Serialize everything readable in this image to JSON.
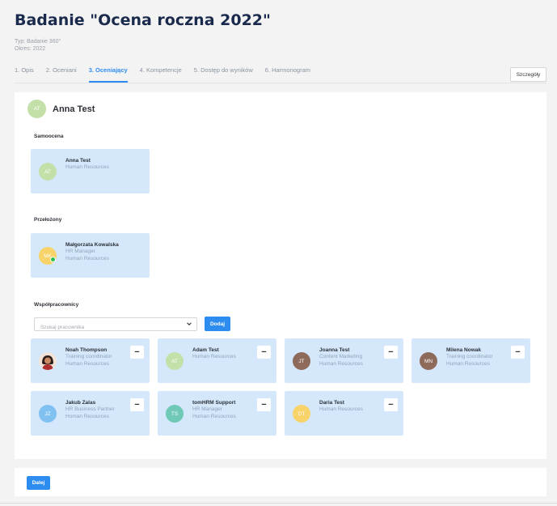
{
  "header": {
    "title": "Badanie \"Ocena roczna 2022\"",
    "type_line": "Typ: Badanie 360°",
    "period_line": "Okres: 2022",
    "details_label": "Szczegóły"
  },
  "tabs": [
    {
      "label": "1. Opis",
      "active": false
    },
    {
      "label": "2. Oceniani",
      "active": false
    },
    {
      "label": "3. Oceniający",
      "active": true
    },
    {
      "label": "4. Kompetencje",
      "active": false
    },
    {
      "label": "5. Dostęp do wyników",
      "active": false
    },
    {
      "label": "6. Harmonogram",
      "active": false
    }
  ],
  "subject": {
    "initials": "AT",
    "name": "Anna Test",
    "avatar_color": "#c3e0a8"
  },
  "self_section": {
    "label": "Samoocena",
    "card": {
      "initials": "AT",
      "name": "Anna Test",
      "lines": [
        "Human Resources"
      ],
      "avatar_color": "#c3e0a8"
    }
  },
  "manager_section": {
    "label": "Przełożony",
    "card": {
      "initials": "MK",
      "name": "Małgorzata Kowalska",
      "lines": [
        "HR Manager",
        "Human Resources"
      ],
      "avatar_color": "#f7d36a",
      "online": true
    }
  },
  "coworkers_section": {
    "label": "Współpracownicy",
    "search_placeholder": "Szukaj pracownika",
    "add_label": "Dodaj",
    "remove_label": "−",
    "cards": [
      {
        "initials": "",
        "photo": true,
        "name": "Noah Thompson",
        "lines": [
          "Training coordinator",
          "Human Resources"
        ],
        "avatar_color": "#ffffff"
      },
      {
        "initials": "AT",
        "name": "Adam Test",
        "lines": [
          "Human Resources"
        ],
        "avatar_color": "#c3e0a8"
      },
      {
        "initials": "JT",
        "name": "Joanna Test",
        "lines": [
          "Content Marketing",
          "Human Resources"
        ],
        "avatar_color": "#8e6a5a"
      },
      {
        "initials": "MN",
        "name": "Milena Nowak",
        "lines": [
          "Training coordinator",
          "Human Resources"
        ],
        "avatar_color": "#8e6a5a"
      },
      {
        "initials": "JZ",
        "name": "Jakub Zalas",
        "lines": [
          "HR Business Partner",
          "Human Resources"
        ],
        "avatar_color": "#80c1f2"
      },
      {
        "initials": "TS",
        "name": "tomHRM Support",
        "lines": [
          "HR Manager",
          "Human Resources"
        ],
        "avatar_color": "#6fc9b6"
      },
      {
        "initials": "DT",
        "name": "Daria Test",
        "lines": [
          "Human Resources"
        ],
        "avatar_color": "#f7d36a"
      }
    ]
  },
  "footer": {
    "next_label": "Dalej"
  },
  "colors": {
    "accent": "#2d8cf0",
    "card_bg": "#d5e8fb"
  }
}
